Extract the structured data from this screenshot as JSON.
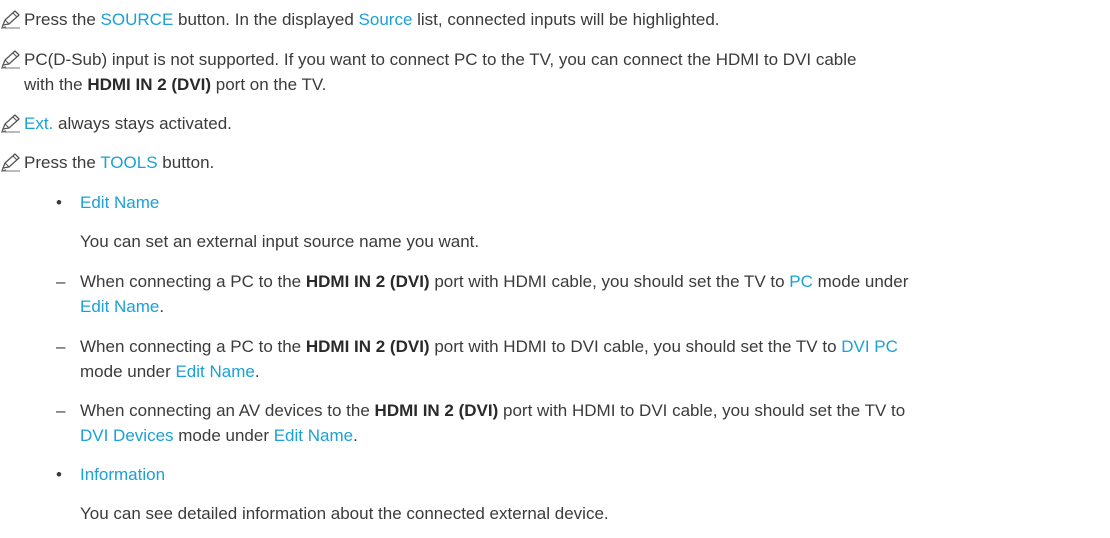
{
  "notes": {
    "n1": {
      "t1": "Press the ",
      "k1": "SOURCE",
      "t2": " button. In the displayed ",
      "k2": "Source",
      "t3": " list, connected inputs will be highlighted."
    },
    "n2": {
      "t1": "PC(D-Sub) input is not supported. If you want to connect PC to the TV, you can connect the HDMI to DVI cable",
      "t2": "with the ",
      "b1": "HDMI IN 2 (DVI)",
      "t3": " port on the TV."
    },
    "n3": {
      "k1": "Ext.",
      "t1": " always stays activated."
    },
    "n4": {
      "t1": "Press the ",
      "k1": "TOOLS",
      "t2": " button."
    }
  },
  "edit_name": {
    "bullet": "•",
    "title": "Edit Name",
    "desc": "You can set an external input source name you want.",
    "dash": "–",
    "d1": {
      "t1": "When connecting a PC to the ",
      "b1": "HDMI IN 2 (DVI)",
      "t2": " port with HDMI cable, you should set the TV to ",
      "k1": "PC",
      "t3": " mode under ",
      "k2": "Edit Name",
      "t4": "."
    },
    "d2": {
      "t1": "When connecting a PC to the ",
      "b1": "HDMI IN 2 (DVI)",
      "t2": " port with HDMI to DVI cable, you should set the TV to ",
      "k1": "DVI PC",
      "t3": " mode under ",
      "k2": "Edit Name",
      "t4": "."
    },
    "d3": {
      "t1": "When connecting an AV devices to the ",
      "b1": "HDMI IN 2 (DVI)",
      "t2": " port with HDMI to DVI cable, you should set the TV to ",
      "k1": "DVI Devices",
      "t3": " mode under ",
      "k2": "Edit Name",
      "t4": "."
    }
  },
  "information": {
    "bullet": "•",
    "title": "Information",
    "desc": "You can see detailed information about the connected external device."
  },
  "colors": {
    "highlight": "#1aa1d6",
    "text": "#3b3b3b"
  },
  "icons": {
    "note": "note-pencil-icon"
  }
}
